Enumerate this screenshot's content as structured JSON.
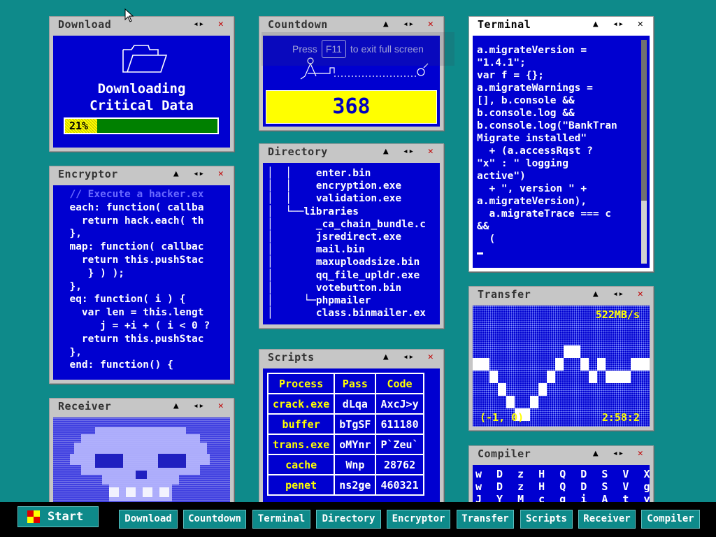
{
  "windows": {
    "download": {
      "title": "Download",
      "heading_line1": "Downloading",
      "heading_line2": "Critical Data",
      "progress_label": "21%",
      "progress": 0.21
    },
    "countdown": {
      "title": "Countdown",
      "value": "368",
      "tip_press": "Press",
      "tip_key": "F11",
      "tip_rest": "to exit full screen"
    },
    "terminal": {
      "title": "Terminal",
      "lines": [
        "a.migrateVersion =",
        "\"1.4.1\";",
        "var f = {};",
        "a.migrateWarnings =",
        "[], b.console &&",
        "b.console.log &&",
        "b.console.log(\"BankTran",
        "Migrate installed\"",
        "  + (a.accessRqst ?",
        "\"x\" : \" logging",
        "active\")",
        "  + \", version \" +",
        "a.migrateVersion),",
        "  a.migrateTrace === c",
        "&&",
        "  ("
      ]
    },
    "directory": {
      "title": "Directory",
      "lines": [
        "│  │    enter.bin",
        "│  │    encryption.exe",
        "│  │    validation.exe",
        "│  └──libraries",
        "│       _ca_chain_bundle.c",
        "│       jsredirect.exe",
        "│       mail.bin",
        "│       maxuploadsize.bin",
        "│       qq_file_upldr.exe",
        "│       votebutton.bin",
        "│     └─phpmailer",
        "│       class.binmailer.ex"
      ]
    },
    "encryptor": {
      "title": "Encryptor",
      "comment": "  // Execute a hacker.ex",
      "lines": [
        "  each: function( callba",
        "    return hack.each( th",
        "  },",
        "  map: function( callbac",
        "    return this.pushStac",
        "     } ) );",
        "  },",
        "  eq: function( i ) {",
        "    var len = this.lengt",
        "       j = +i + ( i < 0 ?",
        "    return this.pushStac",
        "  },",
        "  end: function() {"
      ]
    },
    "transfer": {
      "title": "Transfer",
      "rate": "522MB/s",
      "coords": "(-1, 0)",
      "time": "2:58:2"
    },
    "scripts": {
      "title": "Scripts",
      "headers": [
        "Process",
        "Pass",
        "Code"
      ],
      "rows": [
        [
          "crack.exe",
          "dLqa",
          "AxcJ>y"
        ],
        [
          "buffer",
          "bTgSF",
          "611180"
        ],
        [
          "trans.exe",
          "oMYnr",
          "P`Zeu`"
        ],
        [
          "cache",
          "Wnp",
          "28762"
        ],
        [
          "penet",
          "ns2ge",
          "460321"
        ]
      ]
    },
    "receiver": {
      "title": "Receiver"
    },
    "compiler": {
      "title": "Compiler",
      "rows": [
        "w D z H Q D S V X  B R",
        "w D z H Q D S V g  B R",
        "J Y M c q i A t y  w w"
      ]
    }
  },
  "taskbar": {
    "start_label": "Start",
    "items": [
      "Download",
      "Countdown",
      "Terminal",
      "Directory",
      "Encryptor",
      "Transfer",
      "Scripts",
      "Receiver",
      "Compiler"
    ]
  },
  "colors": {
    "desktop": "#0e8a8a",
    "window_body": "#0000d0",
    "accent_yellow": "#ffff00",
    "progress_green": "#008000",
    "close_red": "#c00000"
  }
}
